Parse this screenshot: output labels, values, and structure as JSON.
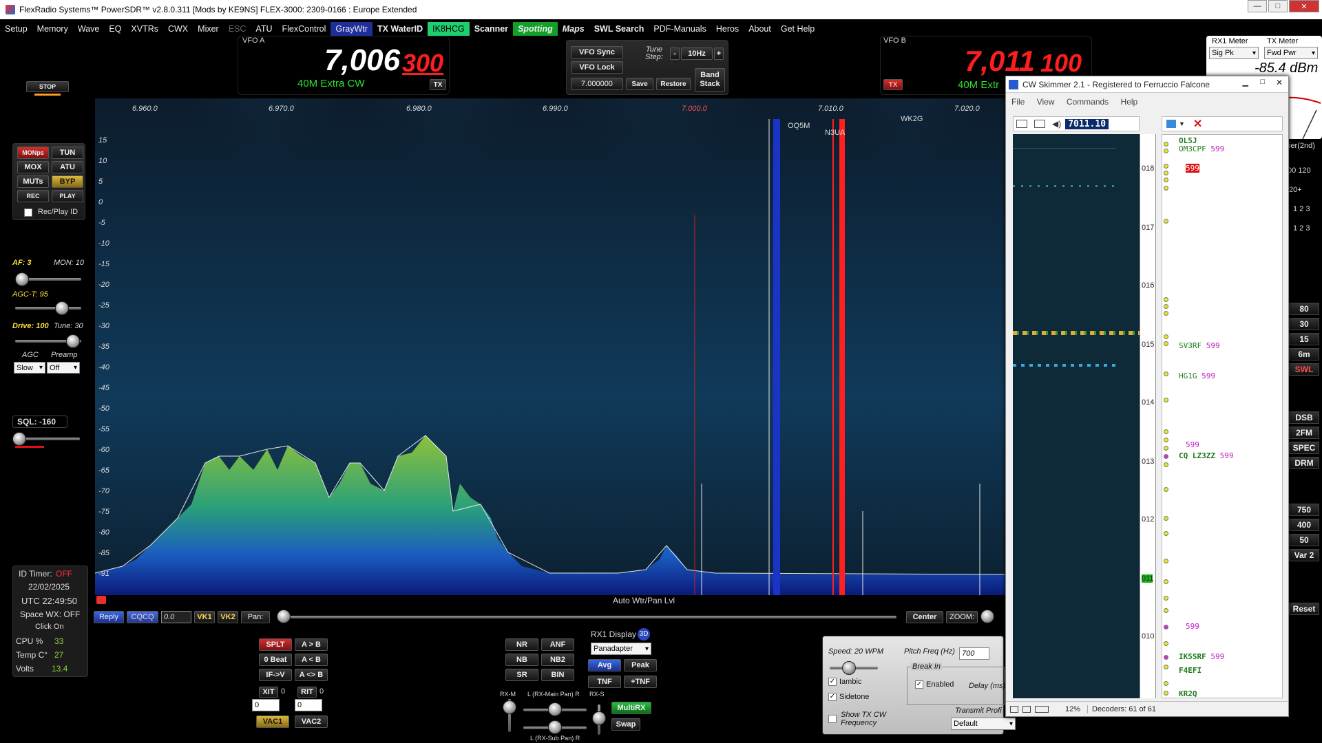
{
  "window": {
    "title": "FlexRadio Systems™  PowerSDR™  v2.8.0.311   [Mods by KE9NS]   FLEX-3000: 2309-0166 : Europe Extended"
  },
  "menu": [
    "Setup",
    "Memory",
    "Wave",
    "EQ",
    "XVTRs",
    "CWX",
    "Mixer",
    "ESC",
    "ATU",
    "FlexControl",
    "GrayWtr",
    "TX WaterID",
    "IK8HCG",
    "Scanner",
    "Spotting",
    "Maps",
    "SWL Search",
    "PDF-Manuals",
    "Heros",
    "About",
    "Get Help"
  ],
  "vfoA": {
    "label": "VFO A",
    "main": "7,006",
    "sub": "300",
    "band": "40M Extra CW",
    "tx": "TX"
  },
  "vfoB": {
    "label": "VFO B",
    "main": "7,011",
    "sub": "100",
    "band": "40M Extr",
    "tx": "TX"
  },
  "center": {
    "vfo_sync": "VFO Sync",
    "vfo_lock": "VFO Lock",
    "tune_step_label": "Tune Step:",
    "tune_step": "10Hz",
    "minus": "-",
    "plus": "+",
    "freq": "7.000000",
    "save": "Save",
    "restore": "Restore",
    "band_stack": "Band Stack"
  },
  "meter": {
    "rx_label": "RX1 Meter",
    "tx_label": "TX Meter",
    "rx_sel": "Sig Pk",
    "tx_sel": "Fwd Pwr",
    "reading": "-85.4 dBm"
  },
  "left": {
    "stop": "STOP",
    "mon": "MONps",
    "tun": "TUN",
    "mox": "MOX",
    "atu": "ATU",
    "mut": "MUTs",
    "byp": "BYP",
    "rec": "REC",
    "play": "PLAY",
    "recplay": "Rec/Play ID",
    "af": "AF: 3",
    "mon_val": "MON: 10",
    "agct": "AGC-T: 95",
    "drive": "Drive: 100",
    "tune": "Tune: 30",
    "agc": "AGC",
    "preamp": "Preamp",
    "agc_sel": "Slow",
    "preamp_sel": "Off",
    "sql": "SQL: -160"
  },
  "status": {
    "id_timer_label": "ID Timer:",
    "id_timer": "OFF",
    "date": "22/02/2025",
    "utc": "UTC  22:49:50",
    "space": "Space WX: OFF",
    "click": "Click On",
    "cpu_label": "CPU %",
    "cpu": "33",
    "temp_label": "Temp C°",
    "temp": "27",
    "volts_label": "Volts",
    "volts": "13.4"
  },
  "spectrum": {
    "freqs": [
      "6.960.0",
      "6.970.0",
      "6.980.0",
      "6.990.0",
      "7.000.0",
      "7.010.0",
      "7.020.0"
    ],
    "dbs": [
      "15",
      "10",
      "5",
      "0",
      "-5",
      "-10",
      "-15",
      "-20",
      "-25",
      "-30",
      "-35",
      "-40",
      "-45",
      "-50",
      "-55",
      "-60",
      "-65",
      "-70",
      "-75",
      "-80",
      "-85",
      "-91"
    ],
    "spots": [
      "OQ5M",
      "N3UA",
      "WK2G"
    ],
    "bottom_label": "Auto Wtr/Pan Lvl"
  },
  "bottombar": {
    "reply": "Reply",
    "cqcq": "CQCQ",
    "val": "0.0",
    "vk1": "VK1",
    "vk2": "VK2",
    "pan": "Pan:",
    "center": "Center",
    "zoom": "ZOOM:"
  },
  "split": {
    "splt": "SPLT",
    "atob": "A > B",
    "beat": "0 Beat",
    "altb": "A < B",
    "ifv": "IF->V",
    "aswap": "A <> B",
    "xit": "XIT",
    "xit_v": "0",
    "rit": "RIT",
    "rit_v": "0",
    "xit_spin": "0",
    "rit_spin": "0",
    "vac1": "VAC1",
    "vac2": "VAC2"
  },
  "dsp": {
    "nr": "NR",
    "anf": "ANF",
    "nb": "NB",
    "nb2": "NB2",
    "sr": "SR",
    "bin": "BIN",
    "rx1disp": "RX1 Display",
    "d3": "3D",
    "disp_sel": "Panadapter",
    "avg": "Avg",
    "peak": "Peak",
    "tnf": "TNF",
    "ptnf": "+TNF",
    "rxm": "RX-M",
    "rxs": "RX-S",
    "mainpan": "L (RX-Main Pan) R",
    "subpan": "L (RX-Sub Pan) R",
    "multirx": "MultiRX",
    "swap": "Swap"
  },
  "cw": {
    "speed": "Speed:  20 WPM",
    "pitch": "Pitch Freq (Hz)",
    "pitch_v": "700",
    "breakin": "Break In",
    "enabled": "Enabled",
    "delay": "Delay (ms)",
    "iambic": "Iambic",
    "sidetone": "Sidetone",
    "showtx": "Show TX CW Frequency",
    "txprof": "Transmit Profi",
    "txprof_sel": "Default"
  },
  "right_buttons": [
    "80",
    "30",
    "15",
    "6m",
    "SWL",
    "DSB",
    "2FM",
    "SPEC",
    "DRM",
    "750",
    "400",
    "50",
    "Var 2",
    "Reset"
  ],
  "right_misc": {
    "filter": "ier(2nd)",
    "n1": "00 120",
    "n2": "20+",
    "n3": "1 2 3",
    "n4": "1 2 3"
  },
  "skimmer": {
    "title": "CW Skimmer 2.1 - Registered to Ferruccio Falcone",
    "menu": [
      "File",
      "View",
      "Commands",
      "Help"
    ],
    "freq": "7011.10",
    "scale": [
      "018",
      "017",
      "016",
      "015",
      "014",
      "013",
      "012",
      "011",
      "010"
    ],
    "spots": [
      {
        "call": "OL5J",
        "rst": ""
      },
      {
        "call": "OM3CPF",
        "rst": "599"
      },
      {
        "call": "",
        "rst": "599"
      },
      {
        "call": "SV3RF",
        "rst": "599"
      },
      {
        "call": "HG1G",
        "rst": "599"
      },
      {
        "call": "",
        "rst": "599"
      },
      {
        "call": "CQ LZ3ZZ",
        "rst": "599"
      },
      {
        "call": "",
        "rst": "599"
      },
      {
        "call": "IK5SRF",
        "rst": "599"
      },
      {
        "call": "F4EFI",
        "rst": ""
      },
      {
        "call": "KR2Q",
        "rst": ""
      }
    ],
    "status_pct": "12%",
    "status_dec": "Decoders: 61 of 61"
  },
  "colors": {
    "accent_red": "#ff2020",
    "vfo_green": "#2ee02e",
    "spectrum_green": "#8ec13a",
    "spectrum_blue": "#1b34c8"
  }
}
